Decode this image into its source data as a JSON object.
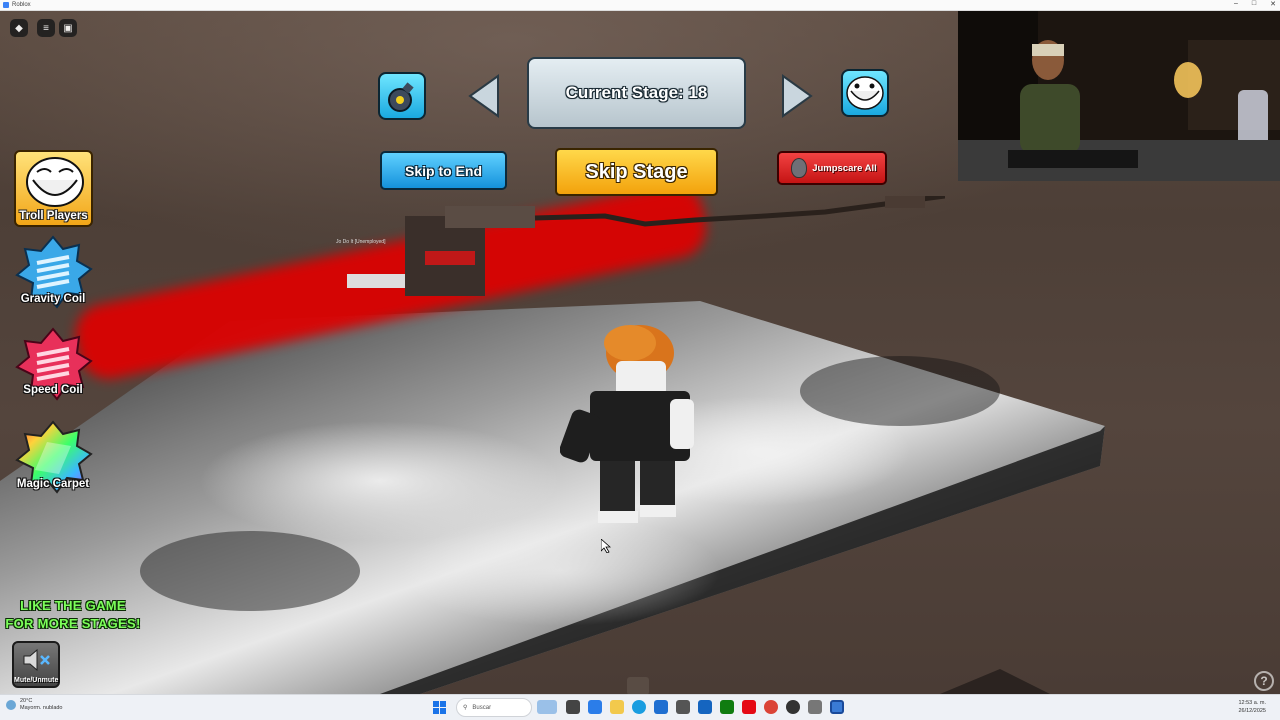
{
  "window": {
    "title": "Roblox"
  },
  "roblox_menu": {
    "logo": "roblox-logo-icon",
    "menu": "hamburger-icon",
    "chat": "chat-icon"
  },
  "stage_bar": {
    "current_stage_label": "Current Stage: 18",
    "skip_to_end_label": "Skip to End",
    "skip_stage_label": "Skip Stage",
    "jumpscare_all_label": "Jumpscare All"
  },
  "powers": [
    {
      "label": "Troll Players",
      "icon": "troll-face-icon"
    },
    {
      "label": "Gravity Coil",
      "icon": "blue-coil-icon"
    },
    {
      "label": "Speed Coil",
      "icon": "red-coil-icon"
    },
    {
      "label": "Magic Carpet",
      "icon": "rainbow-carpet-icon"
    }
  ],
  "promo": {
    "line1": "LIKE THE GAME",
    "line2": "FOR MORE STAGES!"
  },
  "mute_button": {
    "label": "Mute/Unmute"
  },
  "nameplate": "Jo Do It [Unemployed]",
  "taskbar": {
    "weather_temp": "20°C",
    "weather_desc": "Mayorm. nublado",
    "search_placeholder": "Buscar",
    "time": "12:53 a. m.",
    "date": "26/12/2025"
  },
  "colors": {
    "accent_blue": "#1aa9e0",
    "skip_stage_gold": "#f3a20c",
    "jumpscare_red": "#c51414",
    "promo_green": "#7cff5a",
    "laser_red": "#e00000"
  }
}
